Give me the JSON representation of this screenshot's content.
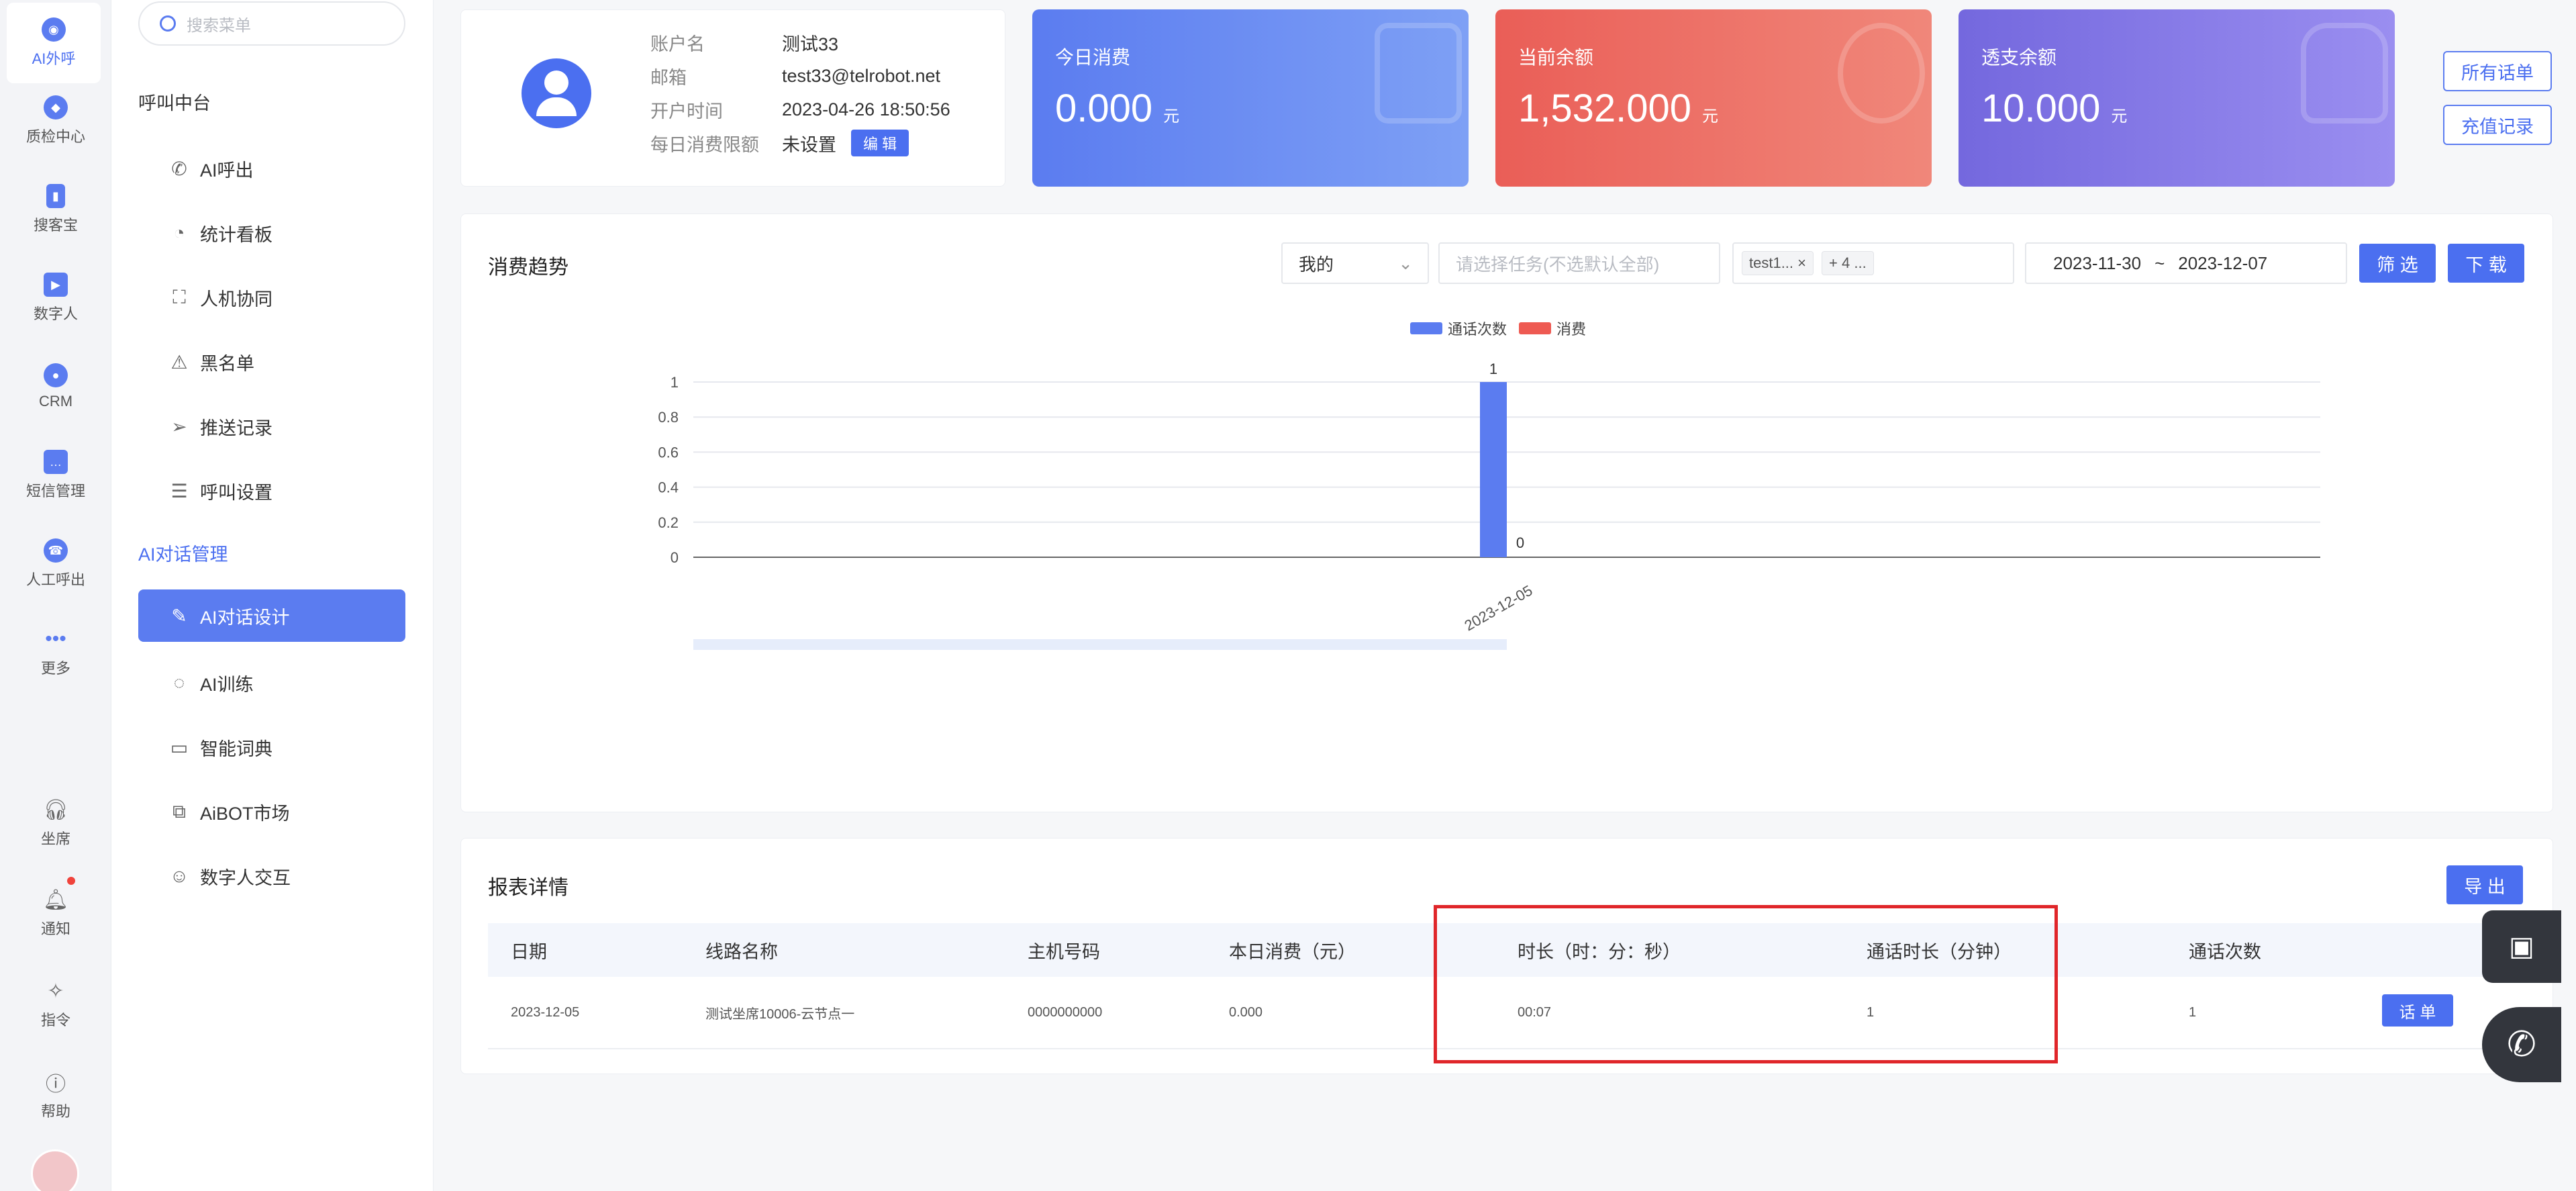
{
  "rail": [
    {
      "label": "AI外呼",
      "icon": "robot-icon",
      "active": true
    },
    {
      "label": "质检中心",
      "icon": "shield-icon"
    },
    {
      "label": "搜客宝",
      "icon": "phone-icon"
    },
    {
      "label": "数字人",
      "icon": "video-icon"
    },
    {
      "label": "CRM",
      "icon": "user-icon"
    },
    {
      "label": "短信管理",
      "icon": "message-icon"
    },
    {
      "label": "人工呼出",
      "icon": "call-icon"
    },
    {
      "label": "更多",
      "icon": "more-icon"
    }
  ],
  "rail_bottom": [
    {
      "label": "坐席",
      "icon": "headset-icon"
    },
    {
      "label": "通知",
      "icon": "bell-icon"
    },
    {
      "label": "指令",
      "icon": "gear-icon"
    },
    {
      "label": "帮助",
      "icon": "help-icon"
    }
  ],
  "menu": {
    "search_placeholder": "搜索菜单",
    "group1": "呼叫中台",
    "group1_items": [
      {
        "label": "AI呼出",
        "icon": "phone-icon"
      },
      {
        "label": "统计看板",
        "icon": "pie-chart-icon"
      },
      {
        "label": "人机协同",
        "icon": "collab-icon"
      },
      {
        "label": "黑名单",
        "icon": "warning-icon"
      },
      {
        "label": "推送记录",
        "icon": "send-icon"
      },
      {
        "label": "呼叫设置",
        "icon": "sliders-icon"
      }
    ],
    "group2": "AI对话管理",
    "group2_items": [
      {
        "label": "AI对话设计",
        "icon": "pencil-icon",
        "active": true
      },
      {
        "label": "AI训练",
        "icon": "chat-icon"
      },
      {
        "label": "智能词典",
        "icon": "book-icon"
      },
      {
        "label": "AiBOT市场",
        "icon": "market-icon"
      },
      {
        "label": "数字人交互",
        "icon": "robot-face-icon"
      }
    ]
  },
  "account": {
    "name_label": "账户名",
    "name": "测试33",
    "email_label": "邮箱",
    "email": "test33@telrobot.net",
    "open_label": "开户时间",
    "open": "2023-04-26 18:50:56",
    "limit_label": "每日消费限额",
    "limit": "未设置",
    "edit_label": "编 辑"
  },
  "stats": [
    {
      "title": "今日消费",
      "value": "0.000",
      "unit": "元",
      "color": "#5b7cf0"
    },
    {
      "title": "当前余额",
      "value": "1,532.000",
      "unit": "元",
      "color": "#ee6a60"
    },
    {
      "title": "透支余额",
      "value": "10.000",
      "unit": "元",
      "color": "#7d74e3"
    }
  ],
  "side_buttons": {
    "all_bills": "所有话单",
    "recharge": "充值记录"
  },
  "trend": {
    "title": "消费趋势",
    "scope": "我的",
    "task_placeholder": "请选择任务(不选默认全部)",
    "tags": [
      "test1...",
      "+ 4 ..."
    ],
    "date_start": "2023-11-30",
    "date_sep": "~",
    "date_end": "2023-12-07",
    "filter_btn": "筛 选",
    "download_btn": "下 载"
  },
  "chart_data": {
    "type": "bar",
    "categories": [
      "2023-12-05"
    ],
    "series": [
      {
        "name": "通话次数",
        "values": [
          1
        ],
        "color": "#5b7cf0"
      },
      {
        "name": "消费",
        "values": [
          0
        ],
        "color": "#ee5a52"
      }
    ],
    "ylim": [
      0,
      1
    ],
    "yticks": [
      "0",
      "0.2",
      "0.4",
      "0.6",
      "0.8",
      "1"
    ],
    "data_labels": [
      "1",
      "0"
    ],
    "legend": "top-center"
  },
  "report": {
    "title": "报表详情",
    "export_btn": "导 出",
    "columns": [
      "日期",
      "线路名称",
      "主机号码",
      "本日消费（元）",
      "时长（时：分：秒）",
      "通话时长（分钟）",
      "通话次数"
    ],
    "rows": [
      {
        "date": "2023-12-05",
        "line": "测试坐席10006-云节点一",
        "host": "0000000000",
        "cost": "0.000",
        "duration": "00:07",
        "minutes": "1",
        "count": "1",
        "action": "话 单"
      }
    ]
  }
}
